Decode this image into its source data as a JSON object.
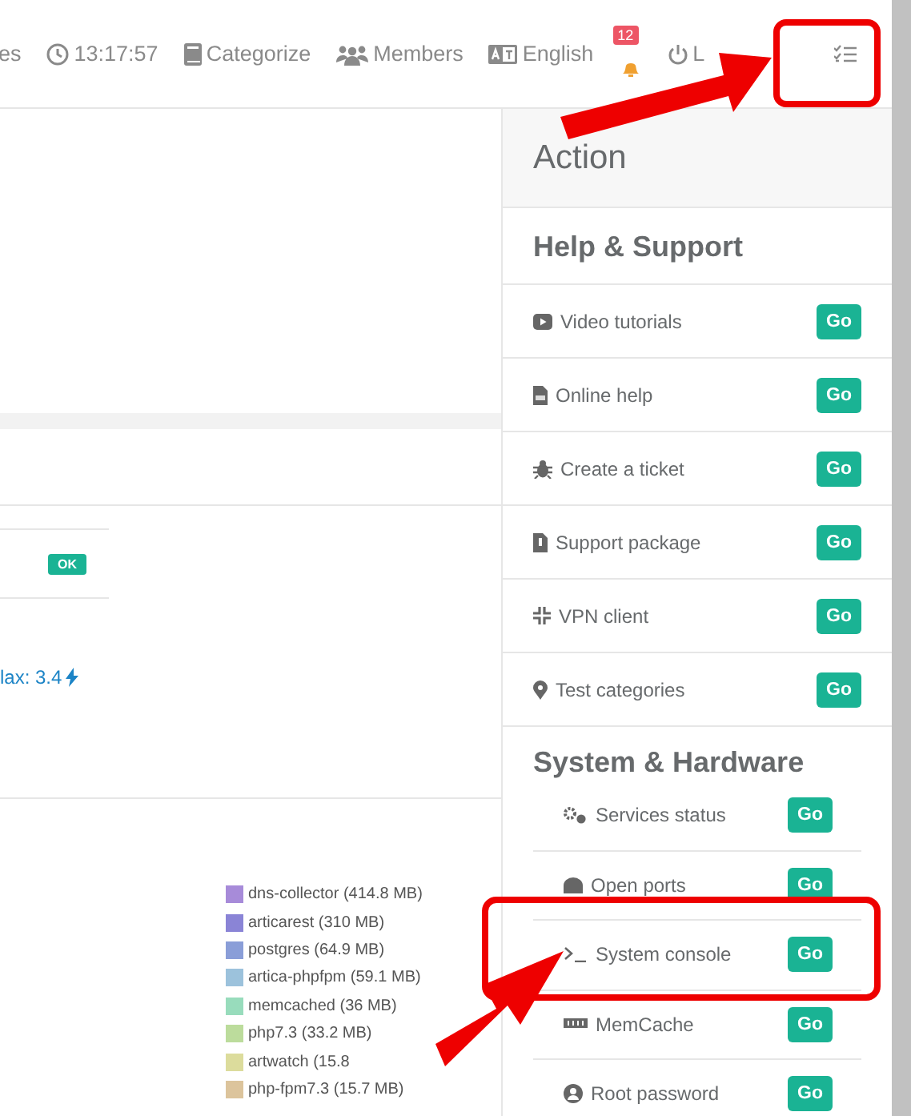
{
  "topbar": {
    "items": [
      {
        "label": "es"
      },
      {
        "label": "13:17:57"
      },
      {
        "label": "Categorize"
      },
      {
        "label": "Members"
      },
      {
        "label": "English"
      },
      {
        "badge": "12"
      },
      {
        "label": "L"
      }
    ]
  },
  "main": {
    "status_badge": "OK",
    "max_label": "lax: 3.4",
    "legend": [
      {
        "label": "dns-collector (414.8 MB)",
        "color": "#a78bd9"
      },
      {
        "label": "articarest (310 MB)",
        "color": "#8a84d6"
      },
      {
        "label": "postgres (64.9 MB)",
        "color": "#8a9ed8"
      },
      {
        "label": "artica-phpfpm (59.1 MB)",
        "color": "#9cc2dc"
      },
      {
        "label": "memcached (36 MB)",
        "color": "#98dcbc"
      },
      {
        "label": "php7.3 (33.2 MB)",
        "color": "#bcdc9c"
      },
      {
        "label": "artwatch (15.8",
        "color": "#dcdc9c"
      },
      {
        "label": "php-fpm7.3 (15.7 MB)",
        "color": "#dcc49c"
      }
    ]
  },
  "action": {
    "title": "Action",
    "help_support": {
      "title": "Help & Support",
      "items": [
        {
          "label": "Video tutorials",
          "button": "Go"
        },
        {
          "label": "Online help",
          "button": "Go"
        },
        {
          "label": "Create a ticket",
          "button": "Go"
        },
        {
          "label": "Support package",
          "button": "Go"
        },
        {
          "label": "VPN client",
          "button": "Go"
        },
        {
          "label": "Test categories",
          "button": "Go"
        }
      ]
    },
    "system_hardware": {
      "title": "System & Hardware",
      "items": [
        {
          "label": "Services status",
          "button": "Go"
        },
        {
          "label": "Open ports",
          "button": "Go"
        },
        {
          "label": "System console",
          "button": "Go"
        },
        {
          "label": "MemCache",
          "button": "Go"
        },
        {
          "label": "Root password",
          "button": "Go"
        }
      ]
    }
  }
}
